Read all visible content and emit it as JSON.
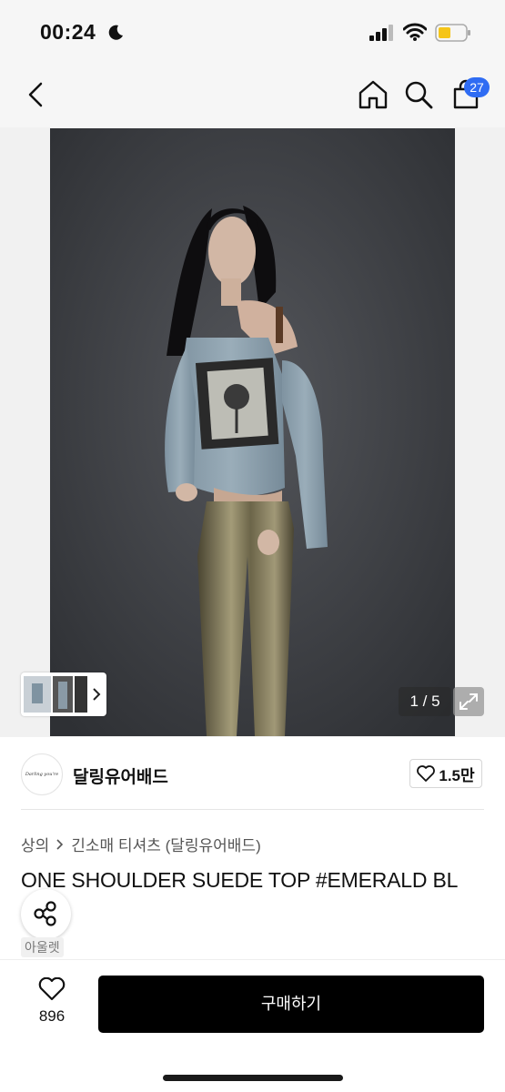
{
  "status_bar": {
    "time": "00:24"
  },
  "nav": {
    "cart_count": "27"
  },
  "gallery": {
    "counter": "1 / 5"
  },
  "shop": {
    "logo_text": "Darling you're bad",
    "name": "달링유어배드",
    "likes": "1.5만"
  },
  "breadcrumb": {
    "level1": "상의",
    "level2": "긴소매 티셔츠 (달링유어배드)"
  },
  "product": {
    "title": "ONE SHOULDER SUEDE TOP #EMERALD BL",
    "tag": "아울렛"
  },
  "bottom_bar": {
    "wish_count": "896",
    "buy_label": "구매하기"
  },
  "colors": {
    "badge": "#2f6cf3",
    "buy_button": "#000000",
    "battery": "#f5c518"
  }
}
